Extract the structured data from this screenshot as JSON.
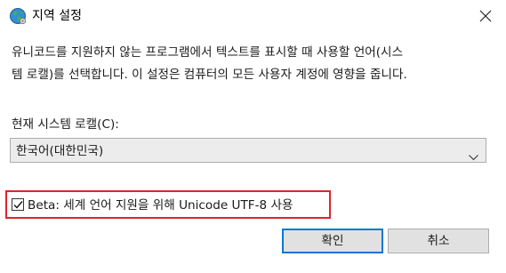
{
  "window": {
    "title": "지역 설정",
    "icon": "globe-icon",
    "close_icon": "close-icon"
  },
  "description": {
    "line1": "유니코드를 지원하지 않는 프로그램에서 텍스트를 표시할 때 사용할 언어(시스",
    "line2": "템 로캘)를 선택합니다. 이 설정은 컴퓨터의 모든 사용자 계정에 영향을 줍니다."
  },
  "locale": {
    "label": "현재 시스템 로캘(C):",
    "selected": "한국어(대한민국)"
  },
  "beta": {
    "label": "Beta: 세계 언어 지원을 위해 Unicode UTF-8 사용",
    "checked": true,
    "highlight_color": "#e0232b"
  },
  "buttons": {
    "ok": "확인",
    "cancel": "취소"
  },
  "colors": {
    "accent": "#0078d7"
  }
}
